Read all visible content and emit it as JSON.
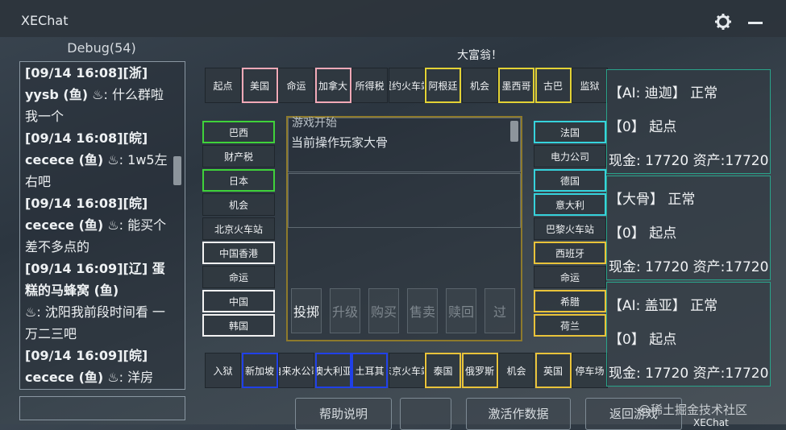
{
  "window": {
    "title": "XEChat"
  },
  "chat": {
    "title": "Debug(54)",
    "messages": [
      {
        "head": "[09/14 16:08][浙]",
        "user": "yysb (鱼)",
        "text": "什么群啦我一个"
      },
      {
        "head": "[09/14 16:08][皖]",
        "user": "cecece (鱼)",
        "text": "1w5左右吧"
      },
      {
        "head": "[09/14 16:08][皖]",
        "user": "cecece (鱼)",
        "text": "能买个差不多点的"
      },
      {
        "head": "[09/14 16:09][辽] 蛋糕的马蜂窝 (鱼)",
        "user": "",
        "text": "沈阳我前段时间看 一万二三吧"
      },
      {
        "head": "[09/14 16:09][皖]",
        "user": "cecece (鱼)",
        "text": "洋房"
      }
    ]
  },
  "board": {
    "title": "大富翁！",
    "top": [
      "起点",
      "美国",
      "命运",
      "加拿大",
      "所得税",
      "纽约火车站",
      "阿根廷",
      "机会",
      "墨西哥",
      "古巴",
      "监狱"
    ],
    "left": [
      "巴西",
      "财产税",
      "日本",
      "机会",
      "北京火车站",
      "中国香港",
      "命运",
      "中国",
      "韩国"
    ],
    "right": [
      "法国",
      "电力公司",
      "德国",
      "意大利",
      "巴黎火车站",
      "西班牙",
      "命运",
      "希腊",
      "荷兰"
    ],
    "bottom": [
      "入狱",
      "新加坡",
      "自来水公司",
      "澳大利亚",
      "土耳其",
      "东京火车站",
      "泰国",
      "俄罗斯",
      "机会",
      "英国",
      "停车场"
    ],
    "colors": {
      "red": "#f2a9b7",
      "yellow": "#e3d235",
      "green": "#3fd23a",
      "cyan": "#36d3dc",
      "white": "#f2f2f2",
      "blue": "#2040e8",
      "gold": "#e9c33a",
      "none": "#1f262c"
    }
  },
  "log": {
    "line1": "游戏开始",
    "line2": "当前操作玩家大骨"
  },
  "actions": [
    "投掷",
    "升级",
    "购买",
    "售卖",
    "赎回",
    "过"
  ],
  "players": [
    {
      "name": "【AI: 迪迦】 正常",
      "pos": "【0】 起点",
      "money": "现金: 17720 资产:17720"
    },
    {
      "name": "【大骨】 正常",
      "pos": "【0】 起点",
      "money": "现金: 17720 资产:17720"
    },
    {
      "name": "【AI: 盖亚】 正常",
      "pos": "【0】 起点",
      "money": "现金: 17720 资产:17720"
    }
  ],
  "bottom_buttons": [
    "帮助说明",
    "",
    "激活作数据",
    "返回游戏"
  ],
  "watermark": "@稀土掘金技术社区",
  "taskbar": "XEChat"
}
